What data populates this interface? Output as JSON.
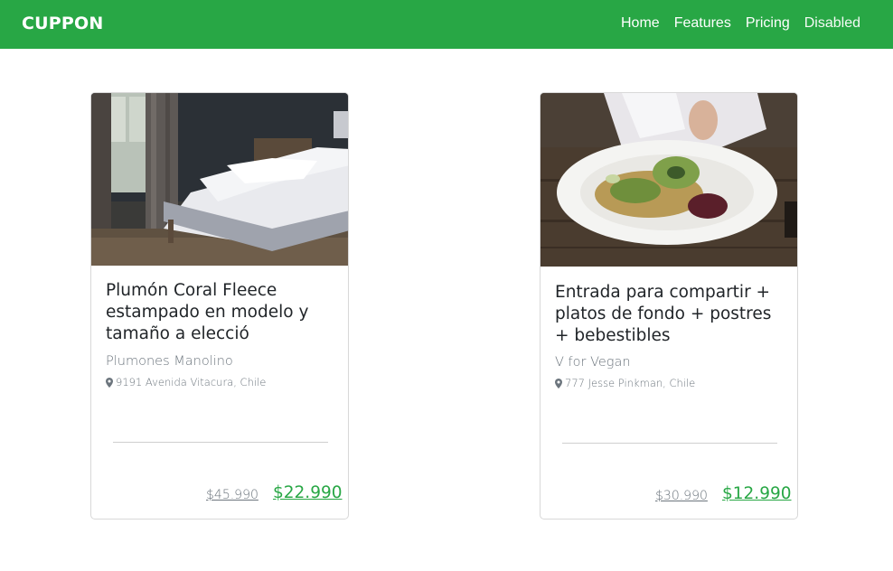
{
  "brand": "CUPPON",
  "nav": [
    {
      "label": "Home"
    },
    {
      "label": "Features"
    },
    {
      "label": "Pricing"
    },
    {
      "label": "Disabled"
    }
  ],
  "colors": {
    "navbar": "#28a745",
    "price": "#28a745",
    "muted": "#6c757d"
  },
  "cards": [
    {
      "image": "bedroom-photo",
      "title": "Plumón Coral Fleece estampado en modelo y tamaño a elecció",
      "vendor": "Plumones Manolino",
      "address_icon": "map-marker-icon",
      "address": "9191 Avenida Vitacura, Chile",
      "old_price": "$45.990",
      "new_price": "$22.990"
    },
    {
      "image": "salad-plate-photo",
      "title": "Entrada para compartir + platos de fondo + postres + bebestibles",
      "vendor": "V for Vegan",
      "address_icon": "map-marker-icon",
      "address": "777 Jesse Pinkman, Chile",
      "old_price": "$30.990",
      "new_price": "$12.990"
    }
  ]
}
